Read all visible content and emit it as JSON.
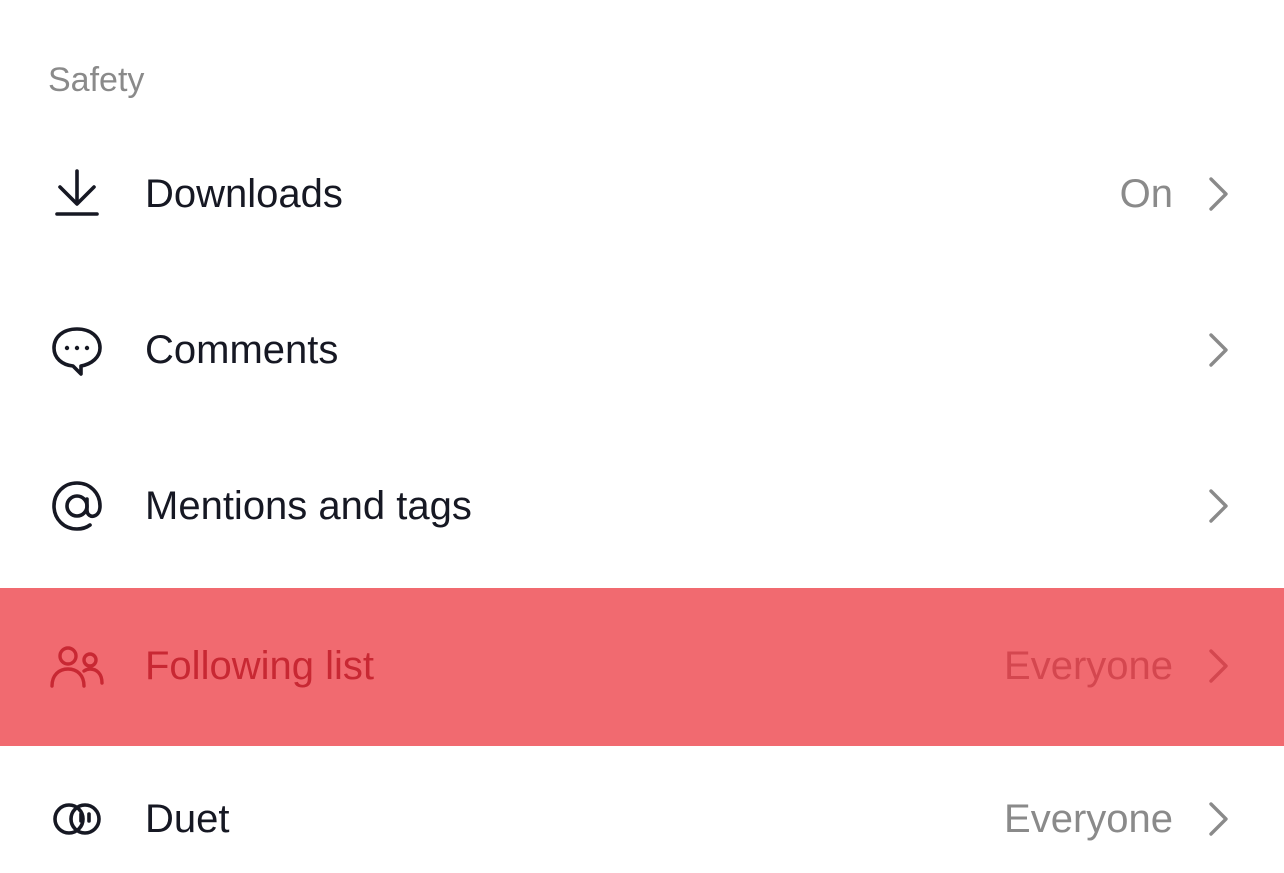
{
  "section": {
    "title": "Safety"
  },
  "rows": [
    {
      "label": "Downloads",
      "value": "On",
      "icon": "download-icon"
    },
    {
      "label": "Comments",
      "value": "",
      "icon": "comment-bubble-icon"
    },
    {
      "label": "Mentions and tags",
      "value": "",
      "icon": "at-sign-icon"
    },
    {
      "label": "Following list",
      "value": "Everyone",
      "icon": "people-icon",
      "highlighted": true
    },
    {
      "label": "Duet",
      "value": "Everyone",
      "icon": "duet-icon"
    }
  ],
  "colors": {
    "highlight_background": "#f16a70",
    "highlight_text": "#c82833",
    "primary_text": "#161823",
    "secondary_text": "#8a8a8a"
  }
}
